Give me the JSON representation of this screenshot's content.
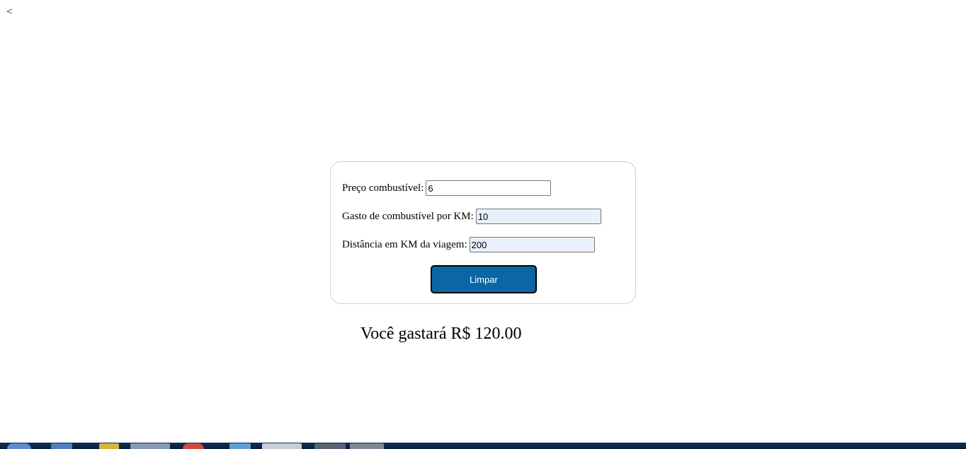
{
  "nav": {
    "back_label": "<"
  },
  "form": {
    "fuel_price": {
      "label": "Preço combustível:",
      "value": "6"
    },
    "fuel_per_km": {
      "label": "Gasto de combustível por KM:",
      "value": "10"
    },
    "distance_km": {
      "label": "Distância em KM da viagem:",
      "value": "200"
    },
    "clear_button_label": "Limpar"
  },
  "result": {
    "text": "Você gastará R$ 120.00"
  },
  "colors": {
    "button_background": "#0a66a5",
    "button_text": "#ffffff",
    "autofill_background": "#e8f0fe",
    "card_border": "#cfcfcf"
  },
  "taskbar": {
    "icons": [
      "start-orb-icon",
      "app-icon",
      "folder-icon",
      "explorer-icon",
      "chrome-icon",
      "ie-icon",
      "chrome-window-icon",
      "terminal-icon",
      "document-icon"
    ]
  }
}
